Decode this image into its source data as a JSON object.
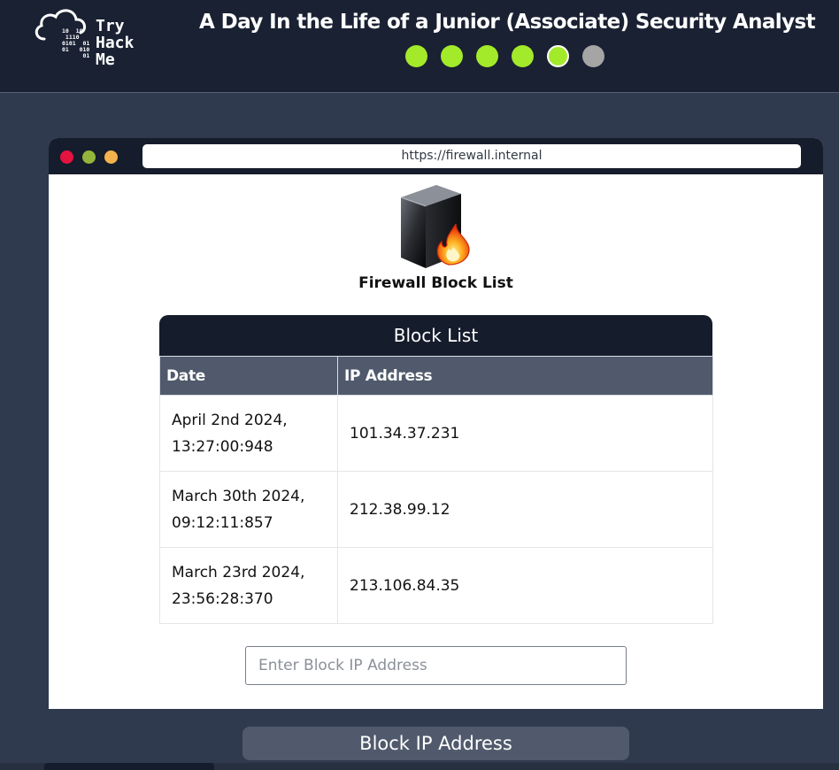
{
  "header": {
    "logo_text": [
      "Try",
      "Hack",
      "Me"
    ],
    "logo_bits": "10  10\n 1110\n0101  01\n01   010\n      01",
    "title": "A Day In the Life of a Junior (Associate) Security Analyst",
    "progress": {
      "total_steps": 6,
      "current_step": 5,
      "completed_steps": 4
    },
    "colors": {
      "active": "#a3ea2a",
      "inactive": "#a5a5a5"
    }
  },
  "browser": {
    "url": "https://firewall.internal"
  },
  "page": {
    "icon": "firewall-icon",
    "title": "Firewall Block List",
    "block_list": {
      "heading": "Block List",
      "columns": [
        "Date",
        "IP Address"
      ],
      "rows": [
        {
          "date": "April 2nd 2024,\n13:27:00:948",
          "ip": "101.34.37.231"
        },
        {
          "date": "March 30th 2024,\n09:12:11:857",
          "ip": "212.38.99.12"
        },
        {
          "date": "March 23rd 2024,\n23:56:28:370",
          "ip": "213.106.84.35"
        }
      ]
    },
    "ip_input": {
      "value": "",
      "placeholder": "Enter Block IP Address"
    },
    "submit_label": "Block IP Address"
  }
}
